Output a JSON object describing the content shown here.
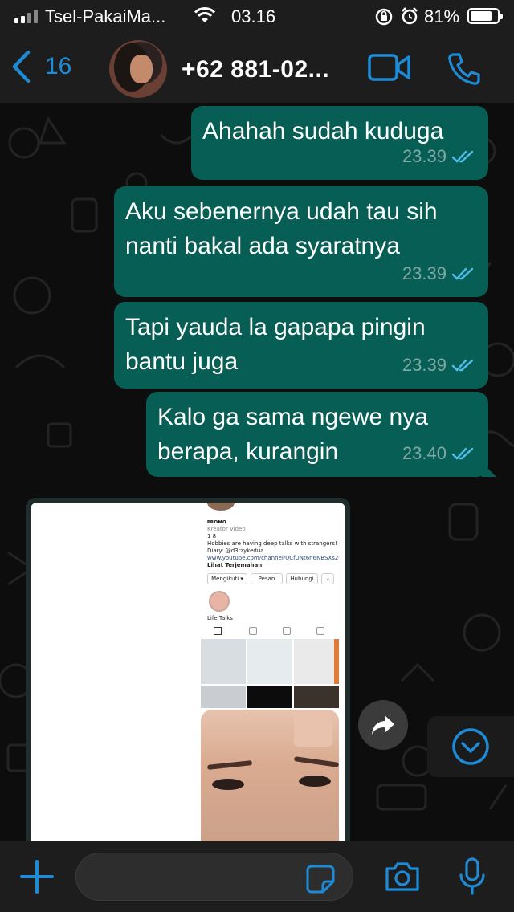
{
  "status_bar": {
    "carrier": "Tsel-PakaiMa...",
    "time": "03.16",
    "battery_percent": "81%",
    "battery_level": 0.81
  },
  "header": {
    "back_count": "16",
    "contact_name": "+62 881-02..."
  },
  "messages": [
    {
      "text": "Ahahah sudah kuduga",
      "time": "23.39",
      "status": "read"
    },
    {
      "text": "Aku sebenernya udah tau sih nanti bakal ada syaratnya",
      "time": "23.39",
      "status": "read"
    },
    {
      "text": "Tapi yauda la gapapa pingin bantu juga",
      "time": "23.39",
      "status": "read"
    },
    {
      "text": "Kalo ga sama ngewe nya berapa, kurangin",
      "time": "23.40",
      "status": "read"
    }
  ],
  "image_message": {
    "profile": {
      "name": "ᴘʀᴏмᴏ",
      "category": "Kreator Video",
      "stats": "1  8",
      "bio_line1": "Hobbies are having deep talks with strangers!",
      "bio_line2": "Diary: @d3rzykedua",
      "link": "www.youtube.com/channel/UCfUNt6n6NBSXs2Q2...",
      "translate": "Lihat Terjemahan",
      "btn_following": "Mengikuti ▾",
      "btn_message": "Pesan",
      "btn_contact": "Hubungi",
      "highlight_label": "Life Talks"
    }
  },
  "colors": {
    "accent": "#1e8bd6",
    "bubble": "#075e54",
    "background": "#0d0d0d",
    "read_ticks": "#53bdeb"
  },
  "icons": {
    "back": "chevron-left-icon",
    "video": "video-camera-icon",
    "call": "phone-icon",
    "forward": "forward-arrow-icon",
    "scroll_down": "chevron-down-circle-icon",
    "plus": "plus-icon",
    "sticker": "sticker-icon",
    "camera": "camera-icon",
    "mic": "microphone-icon"
  }
}
